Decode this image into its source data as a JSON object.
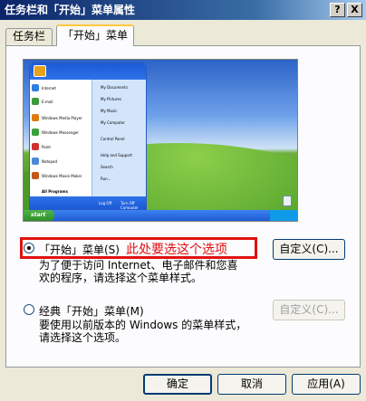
{
  "window": {
    "title": "任务栏和「开始」菜单属性",
    "help_label": "?",
    "close_label": "X"
  },
  "tabs": [
    {
      "label": "任务栏",
      "selected": false
    },
    {
      "label": "「开始」菜单",
      "selected": true
    }
  ],
  "preview": {
    "start_label": "start",
    "left_items": [
      "Internet",
      "E-mail",
      "Windows Media Player",
      "Windows Messenger",
      "Paint",
      "Notepad",
      "Windows Movie Maker"
    ],
    "right_items": [
      "My Documents",
      "My Pictures",
      "My Music",
      "My Computer",
      "Control Panel",
      "Help and Support",
      "Search",
      "Run..."
    ],
    "all_programs": "All Programs",
    "logoff": "Log Off",
    "turnoff": "Turn Off Computer"
  },
  "options": {
    "start_menu": {
      "label": "「开始」菜单(S)",
      "selected": true,
      "annotation": "此处要选这个选项",
      "desc_line1": "为了便于访问 Internet、电子邮件和您喜",
      "desc_line2": "欢的程序，请选择这个菜单样式。",
      "customize_label": "自定义(C)..."
    },
    "classic_menu": {
      "label": "经典「开始」菜单(M)",
      "selected": false,
      "desc_line1": "要使用以前版本的 Windows 的菜单样式，",
      "desc_line2": "请选择这个选项。",
      "customize_label": "自定义(C)..."
    }
  },
  "footer": {
    "ok_label": "确定",
    "cancel_label": "取消",
    "apply_label": "应用(A)"
  }
}
